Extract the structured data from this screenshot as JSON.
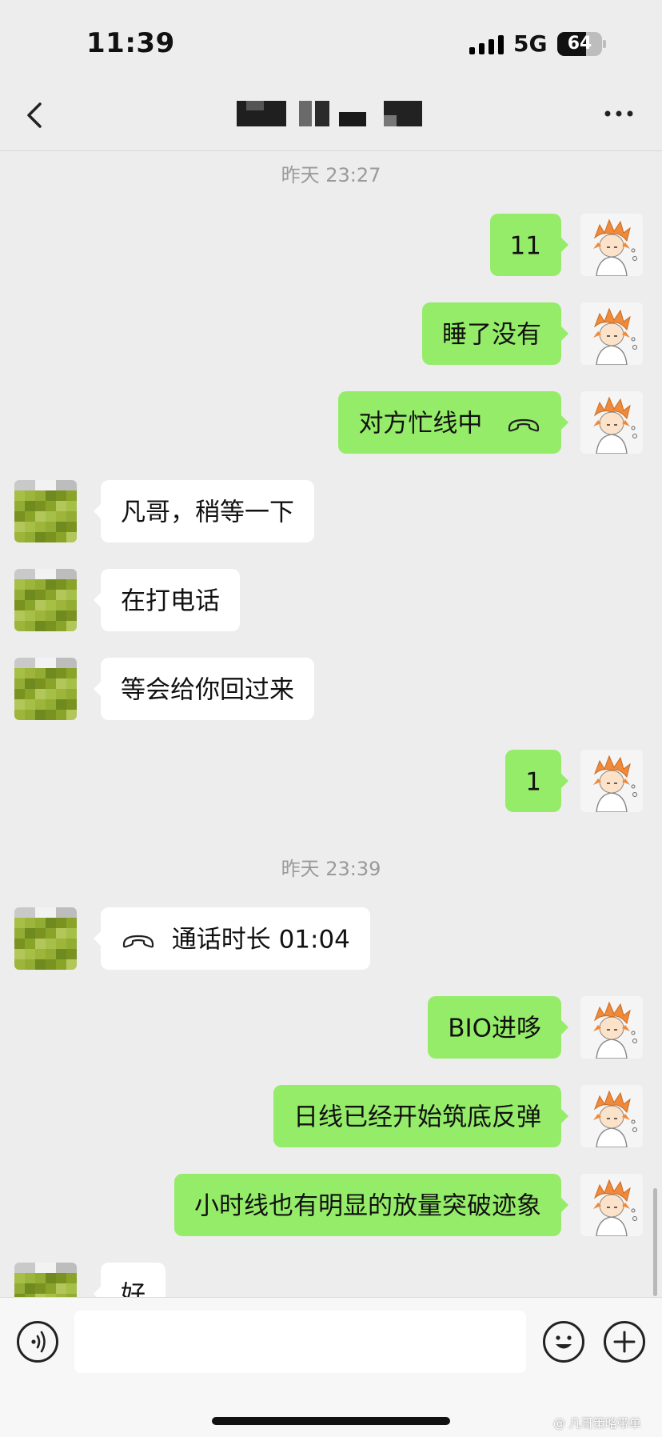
{
  "status_bar": {
    "time": "11:39",
    "network": "5G",
    "battery": "64",
    "battery_level": 0.64
  },
  "nav": {
    "back_icon": "chevron-left-icon",
    "title_note": "",
    "more_icon": "more-dots-icon"
  },
  "chat": {
    "timestamps": [
      "昨天 23:27",
      "昨天 23:39"
    ],
    "messages": [
      {
        "side": "out",
        "text": "11"
      },
      {
        "side": "out",
        "text": "睡了没有"
      },
      {
        "side": "out",
        "text": "对方忙线中",
        "icon": "phone-hangup-icon"
      },
      {
        "side": "in",
        "text": "凡哥，稍等一下"
      },
      {
        "side": "in",
        "text": "在打电话"
      },
      {
        "side": "in",
        "text": "等会给你回过来"
      },
      {
        "side": "out",
        "text": "1"
      },
      {
        "side": "in",
        "text": "通话时长 01:04",
        "icon": "phone-hangup-icon"
      },
      {
        "side": "out",
        "text": "BIO进哆"
      },
      {
        "side": "out",
        "text": "日线已经开始筑底反弹"
      },
      {
        "side": "out",
        "text": "小时线也有明显的放量突破迹象"
      },
      {
        "side": "in",
        "text": "好"
      }
    ]
  },
  "input_bar": {
    "voice_icon": "voice-icon",
    "emoji_icon": "emoji-icon",
    "plus_icon": "plus-icon"
  },
  "watermark": "@ 凡哥策略带单",
  "colors": {
    "outgoing_bubble": "#95ec69",
    "incoming_bubble": "#ffffff",
    "background": "#ededed"
  }
}
